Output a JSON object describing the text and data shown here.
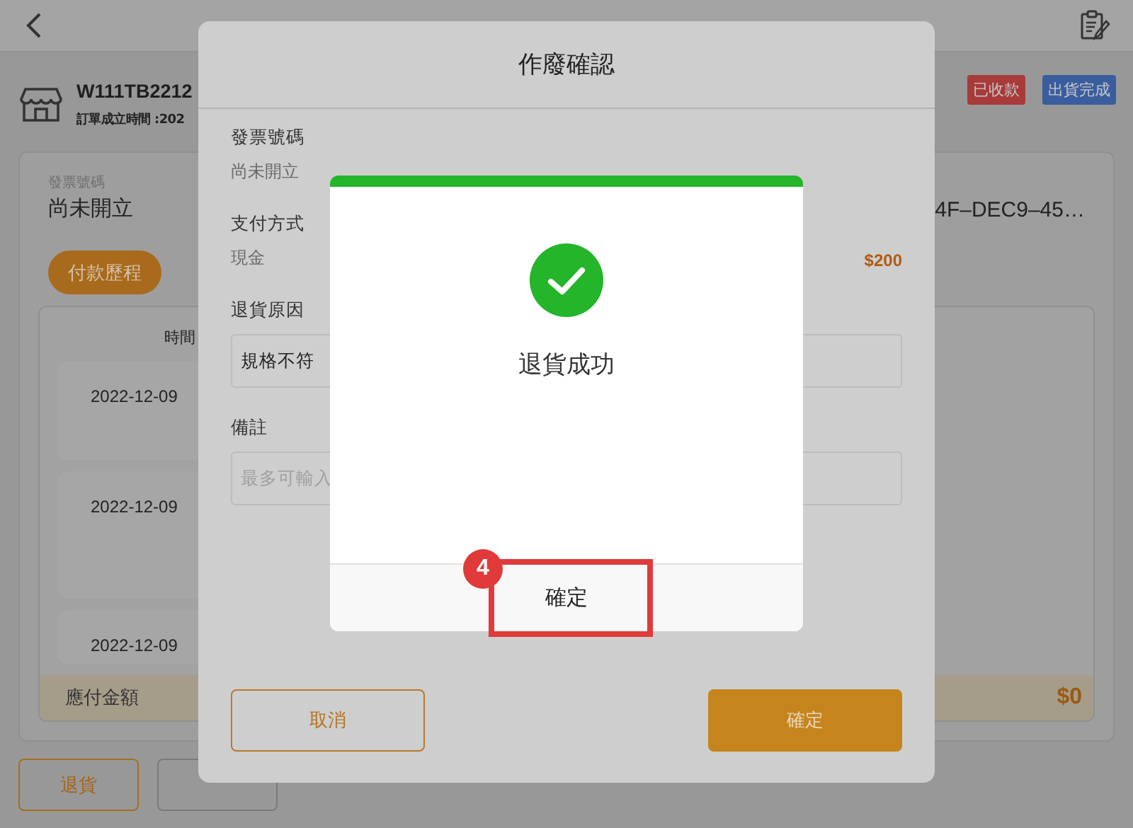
{
  "order": {
    "id": "W111TB2212",
    "created_label": "訂單成立時間 :202",
    "tags": [
      {
        "label": "已收款",
        "color": "#a83a3a"
      },
      {
        "label": "出貨完成",
        "color": "#3a5d9e"
      }
    ]
  },
  "invoice": {
    "label": "發票號碼",
    "value": "尚未開立",
    "code": "4F–DEC9–45…"
  },
  "tabs": [
    {
      "label": "付款歷程",
      "selected": true
    }
  ],
  "history": {
    "column": "時間",
    "rows": [
      "2022-12-09",
      "2022-12-09",
      "2022-12-09"
    ],
    "total_label": "應付金額",
    "total": "$0"
  },
  "page_buttons": [
    {
      "label": "退貨"
    }
  ],
  "modal": {
    "title": "作廢確認",
    "invoice_label": "發票號碼",
    "invoice_value": "尚未開立",
    "payment_label": "支付方式",
    "payment_value": "現金",
    "amount": "$200",
    "reason_label": "退貨原因",
    "reason_value": "規格不符",
    "note_label": "備註",
    "note_placeholder": "最多可輸入",
    "cancel": "取消",
    "confirm": "確定"
  },
  "success": {
    "message": "退貨成功",
    "button": "確定"
  },
  "step_marker": "4"
}
